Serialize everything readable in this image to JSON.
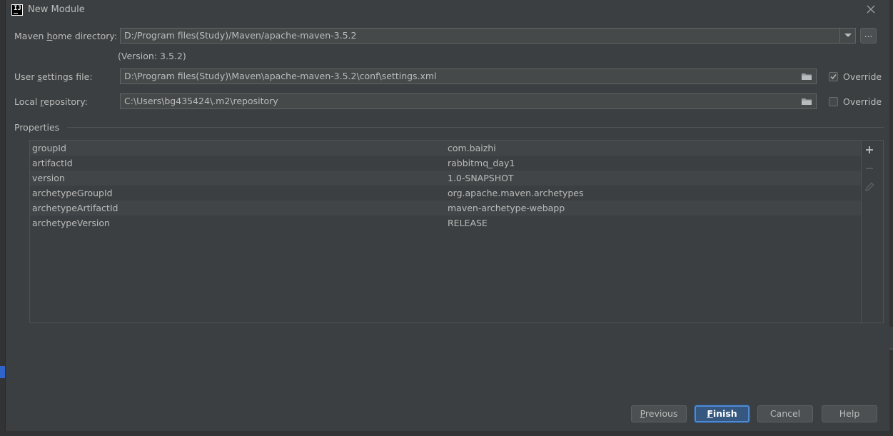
{
  "window": {
    "title": "New Module",
    "app_icon_text": "IJ"
  },
  "maven_home": {
    "label_pre": "Maven ",
    "label_mnemonic": "h",
    "label_post": "ome directory:",
    "value": "D:/Program files(Study)/Maven/apache-maven-3.5.2",
    "browse_label": "...",
    "version_text": "(Version: 3.5.2)"
  },
  "user_settings": {
    "label_pre": "User ",
    "label_mnemonic": "s",
    "label_post": "ettings file:",
    "value": "D:\\Program files(Study)\\Maven\\apache-maven-3.5.2\\conf\\settings.xml",
    "override_label": "Override",
    "override_checked": true
  },
  "local_repo": {
    "label_pre": "Local ",
    "label_mnemonic": "r",
    "label_post": "epository:",
    "value": "C:\\Users\\bg435424\\.m2\\repository",
    "override_label": "Override",
    "override_checked": false
  },
  "properties": {
    "section_title": "Properties",
    "rows": [
      {
        "key": "groupId",
        "value": "com.baizhi"
      },
      {
        "key": "artifactId",
        "value": "rabbitmq_day1"
      },
      {
        "key": "version",
        "value": "1.0-SNAPSHOT"
      },
      {
        "key": "archetypeGroupId",
        "value": "org.apache.maven.archetypes"
      },
      {
        "key": "archetypeArtifactId",
        "value": "maven-archetype-webapp"
      },
      {
        "key": "archetypeVersion",
        "value": "RELEASE"
      }
    ]
  },
  "footer": {
    "previous_mnemonic": "P",
    "previous_rest": "revious",
    "finish_mnemonic": "F",
    "finish_rest": "inish",
    "cancel_label": "Cancel",
    "help_label": "Help"
  },
  "colors": {
    "dialog_bg": "#3c3f41",
    "field_bg": "#45494a",
    "default_button": "#365880",
    "text": "#bbbbbb"
  }
}
